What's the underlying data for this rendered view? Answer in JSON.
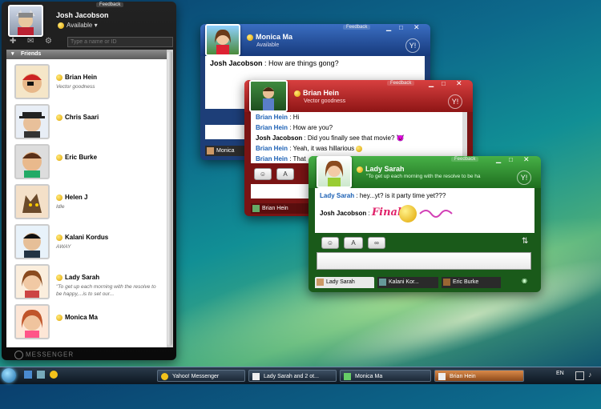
{
  "contact_list": {
    "feedback": "Feedback",
    "user_name": "Josh Jacobson",
    "user_status": "Available",
    "search_placeholder": "Type a name or ID",
    "group_label": "Friends",
    "footer_logo": "MESSENGER",
    "friends": [
      {
        "name": "Brian Hein",
        "status": "Vector goodness"
      },
      {
        "name": "Chris Saari",
        "status": ""
      },
      {
        "name": "Eric Burke",
        "status": ""
      },
      {
        "name": "Helen J",
        "status": "Idle"
      },
      {
        "name": "Kalani Kordus",
        "status": "AWAY"
      },
      {
        "name": "Lady Sarah",
        "status": "\"To get up each morning with the resolve to be happy,...is to set our..."
      },
      {
        "name": "Monica Ma",
        "status": ""
      }
    ]
  },
  "chat_monica": {
    "feedback": "Feedback",
    "name": "Monica Ma",
    "status": "Available",
    "messages": [
      {
        "from": "Josh Jacobson",
        "text": "How are things gong?"
      }
    ],
    "tab_label": "Monica"
  },
  "chat_brian": {
    "feedback": "Feedback",
    "name": "Brian Hein",
    "status": "Vector goodness",
    "messages": [
      {
        "from": "Brian Hein",
        "text": "Hi"
      },
      {
        "from": "Brian Hein",
        "text": "How are you?"
      },
      {
        "from": "Josh Jacobson",
        "text": "Did you finally see that movie?"
      },
      {
        "from": "Brian Hein",
        "text": "Yeah, it was hillarious"
      },
      {
        "from": "Brian Hein",
        "text": "That"
      }
    ],
    "tab_label": "Brian Hein"
  },
  "chat_sarah": {
    "feedback": "Feedback",
    "name": "Lady Sarah",
    "status": "\"To get up each morning with the resolve to be ha",
    "messages": [
      {
        "from": "Lady Sarah",
        "text": "hey...yt? is it party time yet???"
      },
      {
        "from": "Josh Jacobson",
        "text": "Finally"
      }
    ],
    "font_button": "A",
    "tabs": [
      "Lady Sarah",
      "Kalani Kor...",
      "Eric Burke"
    ]
  },
  "taskbar": {
    "items": [
      "Yahoo! Messenger",
      "Lady Sarah and 2 ot...",
      "Monica Ma",
      "Brian Hein"
    ],
    "lang": "EN"
  },
  "colors": {
    "monica_header": "#1f4f9a",
    "brian_header": "#a51d1d",
    "sarah_header": "#2c8a2c",
    "name_blue": "#1a5fb4"
  }
}
